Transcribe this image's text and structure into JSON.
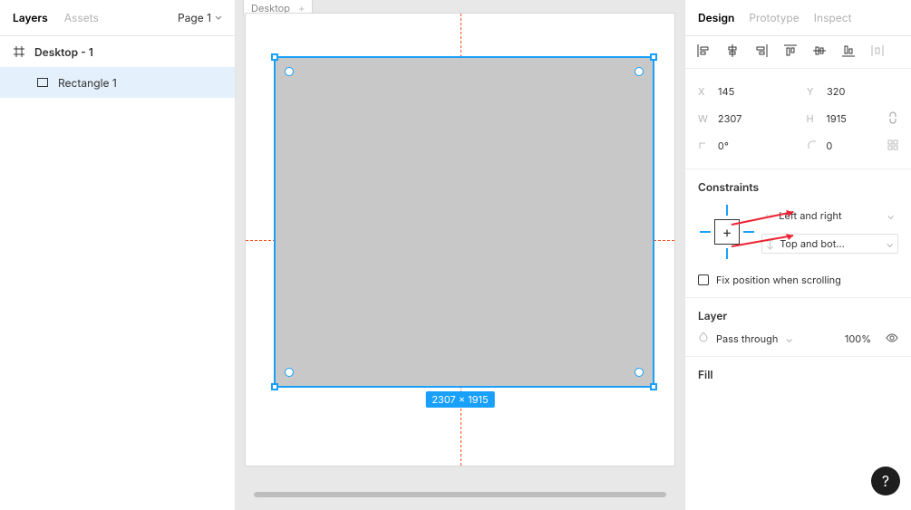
{
  "leftPanel": {
    "tabs": {
      "layers": "Layers",
      "assets": "Assets"
    },
    "pageSelector": "Page 1",
    "frame": {
      "name": "Desktop - 1"
    },
    "child": {
      "name": "Rectangle 1"
    }
  },
  "canvas": {
    "frameTabLabel": "Desktop",
    "frameTabClose": "+",
    "selectionDimensions": "2307 × 1915"
  },
  "rightPanel": {
    "tabs": {
      "design": "Design",
      "prototype": "Prototype",
      "inspect": "Inspect"
    },
    "geometry": {
      "x": {
        "label": "X",
        "value": "145"
      },
      "y": {
        "label": "Y",
        "value": "320"
      },
      "w": {
        "label": "W",
        "value": "2307"
      },
      "h": {
        "label": "H",
        "value": "1915"
      },
      "rot": {
        "label": "⟳",
        "value": "0°"
      },
      "rad": {
        "label": "⌐",
        "value": "0"
      }
    },
    "constraints": {
      "title": "Constraints",
      "horizontal": "Left and right",
      "vertical": "Top and bot…",
      "fixLabel": "Fix position when scrolling"
    },
    "layer": {
      "title": "Layer",
      "blend": "Pass through",
      "opacity": "100%"
    },
    "fill": {
      "title": "Fill"
    },
    "help": "?"
  }
}
